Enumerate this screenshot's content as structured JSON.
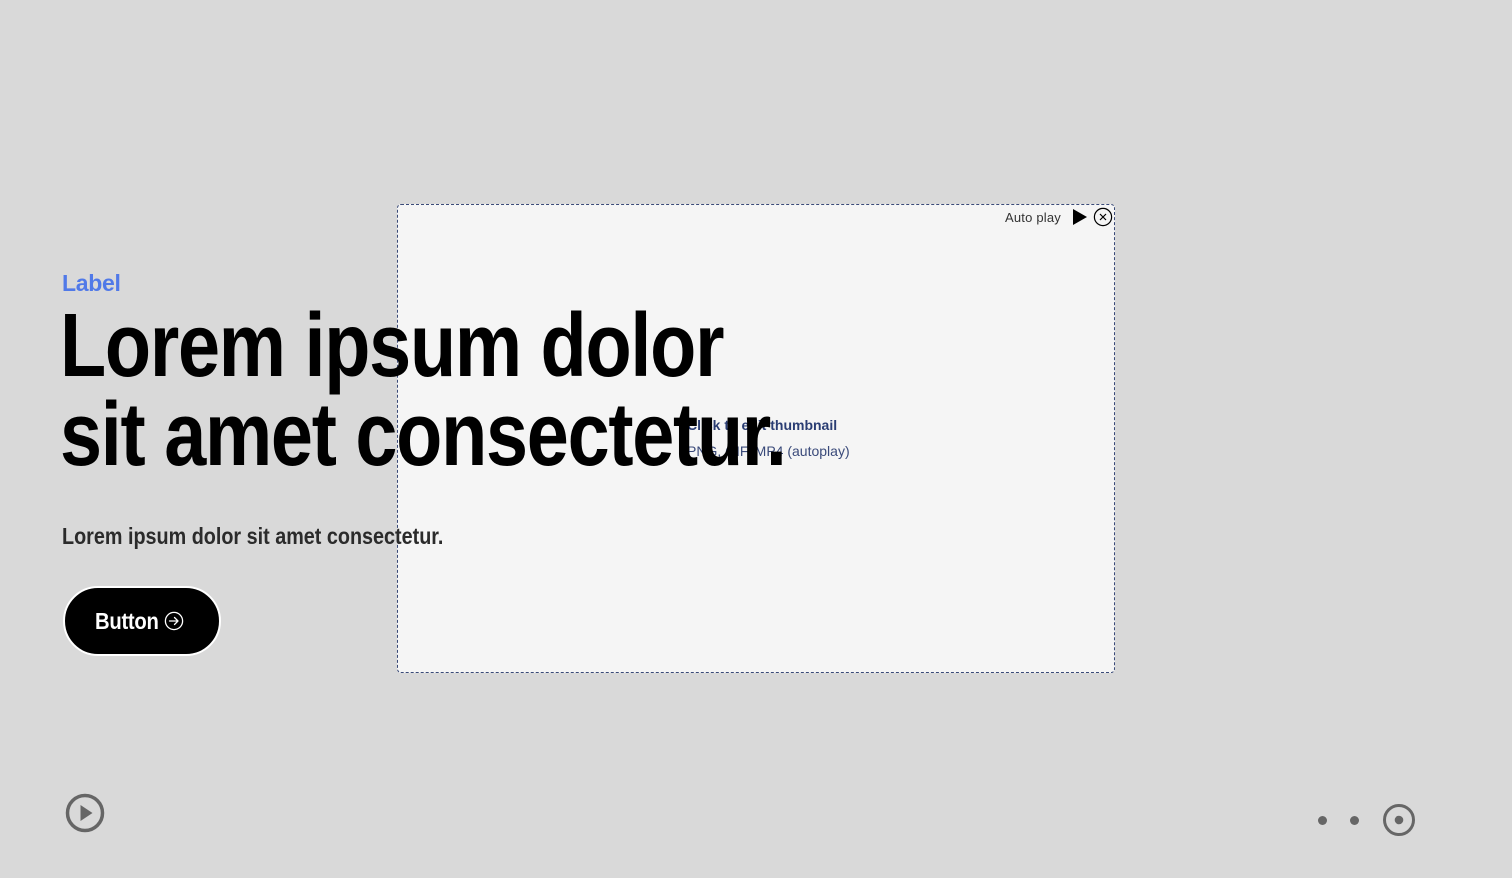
{
  "hero": {
    "label": "Label",
    "heading_line1": "Lorem ipsum dolor",
    "heading_line2": "sit amet consectetur.",
    "subheading": "Lorem ipsum dolor sit amet consectetur.",
    "button_label": "Button",
    "button_icon": "arrow-right-circle-icon"
  },
  "media": {
    "autoplay_label": "Auto play",
    "autoplay_icon": "play-icon",
    "close_icon": "close-circle-icon",
    "placeholder_title": "Click to edit thumbnail",
    "placeholder_hint": "PNG, GIF, MP4 (autoplay)"
  },
  "controls": {
    "play_icon": "play-circle-icon",
    "pager": {
      "count": 3,
      "active_index": 2
    }
  },
  "colors": {
    "background": "#d9d9d9",
    "label_accent": "#5079e8",
    "button_bg": "#000000",
    "panel_bg": "#f5f5f5",
    "panel_border": "#3a4a78",
    "control_gray": "#666666"
  }
}
